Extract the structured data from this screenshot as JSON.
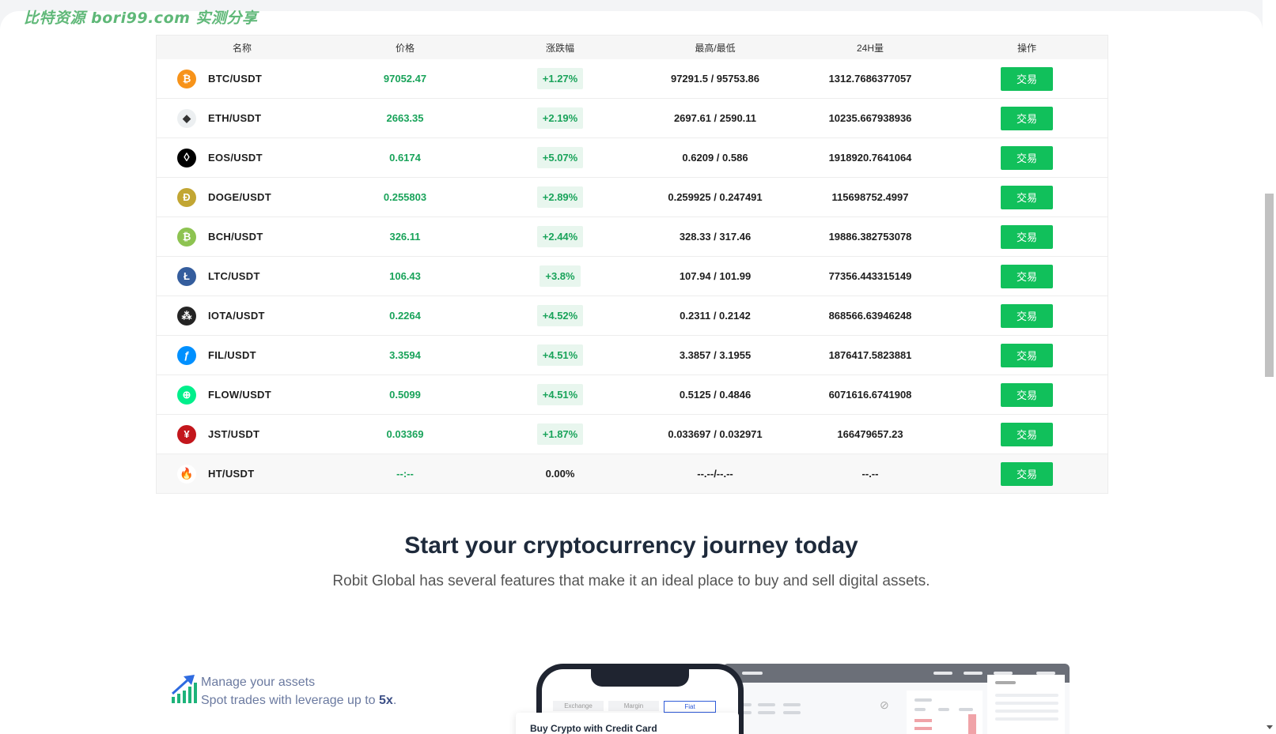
{
  "watermark": "比特资源 bori99.com 实测分享",
  "market": {
    "headers": {
      "name": "名称",
      "price": "价格",
      "change": "涨跌幅",
      "high_low": "最高/最低",
      "volume": "24H量",
      "action": "操作"
    },
    "rows": [
      {
        "pair": "BTC/USDT",
        "price": "97052.47",
        "change": "+1.27%",
        "high_low": "97291.5 / 95753.86",
        "volume": "1312.7686377057",
        "action": "交易",
        "icon": "btc-icon",
        "color": "#f7931a",
        "glyph": "₿"
      },
      {
        "pair": "ETH/USDT",
        "price": "2663.35",
        "change": "+2.19%",
        "high_low": "2697.61 / 2590.11",
        "volume": "10235.667938936",
        "action": "交易",
        "icon": "eth-icon",
        "color": "#eceff1",
        "glyph": "◆"
      },
      {
        "pair": "EOS/USDT",
        "price": "0.6174",
        "change": "+5.07%",
        "high_low": "0.6209 / 0.586",
        "volume": "1918920.7641064",
        "action": "交易",
        "icon": "eos-icon",
        "color": "#000000",
        "glyph": "◊"
      },
      {
        "pair": "DOGE/USDT",
        "price": "0.255803",
        "change": "+2.89%",
        "high_low": "0.259925 / 0.247491",
        "volume": "115698752.4997",
        "action": "交易",
        "icon": "doge-icon",
        "color": "#c2a633",
        "glyph": "Ð"
      },
      {
        "pair": "BCH/USDT",
        "price": "326.11",
        "change": "+2.44%",
        "high_low": "328.33 / 317.46",
        "volume": "19886.382753078",
        "action": "交易",
        "icon": "bch-icon",
        "color": "#8dc351",
        "glyph": "₿"
      },
      {
        "pair": "LTC/USDT",
        "price": "106.43",
        "change": "+3.8%",
        "high_low": "107.94 / 101.99",
        "volume": "77356.443315149",
        "action": "交易",
        "icon": "ltc-icon",
        "color": "#345d9d",
        "glyph": "Ł"
      },
      {
        "pair": "IOTA/USDT",
        "price": "0.2264",
        "change": "+4.52%",
        "high_low": "0.2311 / 0.2142",
        "volume": "868566.63946248",
        "action": "交易",
        "icon": "iota-icon",
        "color": "#242424",
        "glyph": "⁂"
      },
      {
        "pair": "FIL/USDT",
        "price": "3.3594",
        "change": "+4.51%",
        "high_low": "3.3857 / 3.1955",
        "volume": "1876417.5823881",
        "action": "交易",
        "icon": "fil-icon",
        "color": "#0090ff",
        "glyph": "ƒ"
      },
      {
        "pair": "FLOW/USDT",
        "price": "0.5099",
        "change": "+4.51%",
        "high_low": "0.5125 / 0.4846",
        "volume": "6071616.6741908",
        "action": "交易",
        "icon": "flow-icon",
        "color": "#00ef8b",
        "glyph": "⊕"
      },
      {
        "pair": "JST/USDT",
        "price": "0.03369",
        "change": "+1.87%",
        "high_low": "0.033697 / 0.032971",
        "volume": "166479657.23",
        "action": "交易",
        "icon": "jst-icon",
        "color": "#c3161c",
        "glyph": "¥"
      },
      {
        "pair": "HT/USDT",
        "price": "--:--",
        "change": "0.00%",
        "high_low": "--.--/--.--",
        "volume": "--.--",
        "action": "交易",
        "icon": "ht-icon",
        "color": "#ffffff",
        "glyph": "🔥"
      }
    ]
  },
  "hero": {
    "title": "Start your cryptocurrency journey today",
    "subtitle": "Robit Global has several features that make it an ideal place to buy and sell digital assets."
  },
  "feature": {
    "line1": "Manage your assets",
    "line2_prefix": "Spot trades with leverage up to ",
    "line2_highlight": "5x",
    "line2_suffix": "."
  },
  "mockup": {
    "tabs": [
      "Exchange",
      "Margin",
      "Fiat"
    ],
    "card_title": "Buy Crypto with Credit Card"
  }
}
